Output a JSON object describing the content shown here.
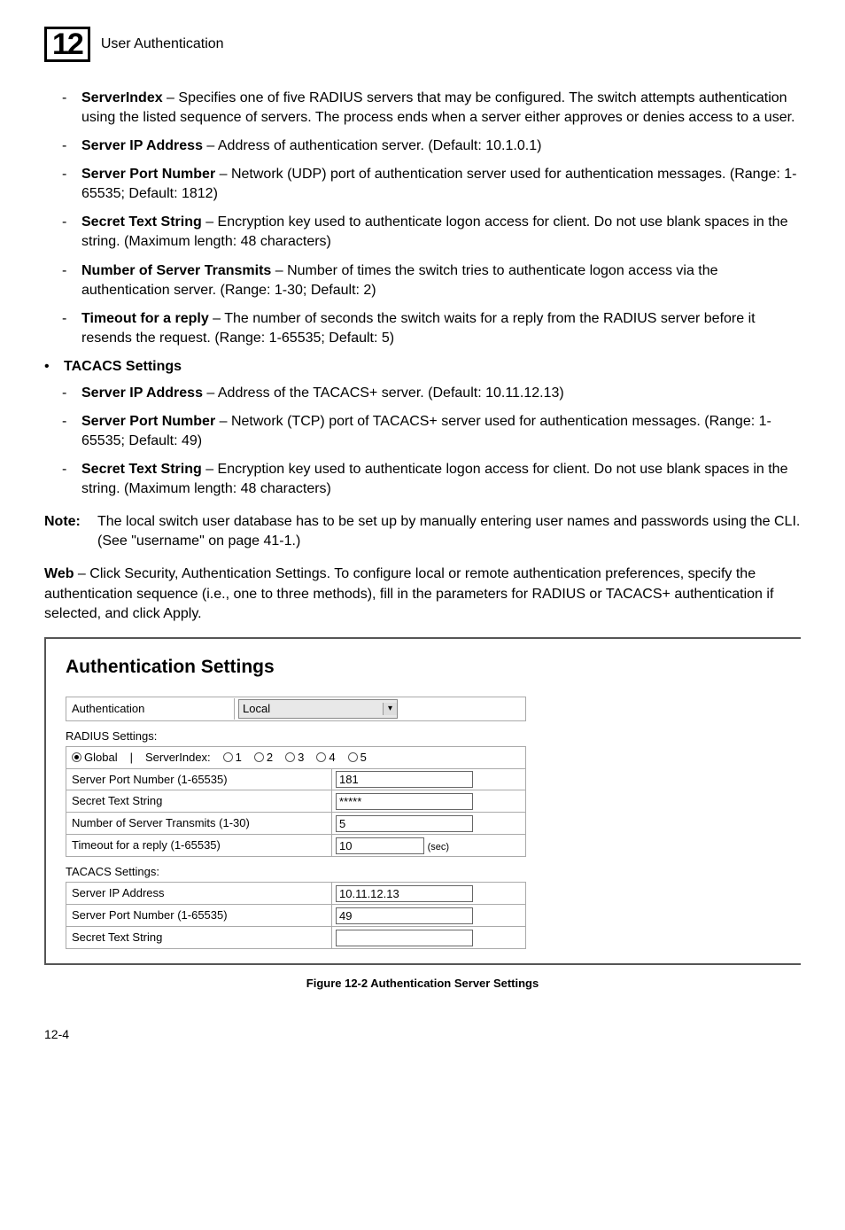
{
  "chapter": {
    "number": "12",
    "title": "User Authentication"
  },
  "items": {
    "serverIndex": {
      "name": "ServerIndex",
      "desc": " – Specifies one of five RADIUS servers that may be configured. The switch attempts authentication using the listed sequence of servers. The process ends when a server either approves or denies access to a user."
    },
    "serverIP1": {
      "name": "Server IP Address",
      "desc": " – Address of authentication server. (Default: 10.1.0.1)"
    },
    "serverPort1": {
      "name": "Server Port Number",
      "desc": " – Network (UDP) port of authentication server used for authentication messages. (Range: 1-65535; Default: 1812)"
    },
    "secret1": {
      "name": "Secret Text String",
      "desc": " – Encryption key used to authenticate logon access for client. Do not use blank spaces in the string. (Maximum length: 48 characters)"
    },
    "transmits": {
      "name": "Number of Server Transmits",
      "desc": " – Number of times the switch tries to authenticate logon access via the authentication server. (Range: 1-30; Default: 2)"
    },
    "timeout": {
      "name": "Timeout for a reply",
      "desc": " – The number of seconds the switch waits for a reply from the RADIUS server before it resends the request. (Range: 1-65535; Default: 5)"
    },
    "tacacs": {
      "name": "TACACS Settings"
    },
    "serverIP2": {
      "name": "Server IP Address",
      "desc": " – Address of the TACACS+ server. (Default: 10.11.12.13)"
    },
    "serverPort2": {
      "name": "Server Port Number",
      "desc": " – Network (TCP) port of TACACS+ server used for authentication messages. (Range: 1-65535; Default: 49)"
    },
    "secret2": {
      "name": "Secret Text String",
      "desc": " – Encryption key used to authenticate logon access for client. Do not use blank spaces in the string. (Maximum length: 48 characters)"
    }
  },
  "note": {
    "label": "Note:",
    "text": "The local switch user database has to be set up by manually entering user names and passwords using the CLI. (See \"username\" on page 41-1.)"
  },
  "webPara": {
    "bold": "Web",
    "text": " – Click Security, Authentication Settings. To configure local or remote authentication preferences, specify the authentication sequence (i.e., one to three methods), fill in the parameters for RADIUS or TACACS+ authentication if selected, and click Apply."
  },
  "screenshot": {
    "title": "Authentication Settings",
    "authLabel": "Authentication",
    "authValue": "Local",
    "radiusHeading": "RADIUS Settings:",
    "globalLabel": "Global",
    "serverIndexLabel": "ServerIndex:",
    "opt1": "1",
    "opt2": "2",
    "opt3": "3",
    "opt4": "4",
    "opt5": "5",
    "portLabel": "Server Port Number (1-65535)",
    "portValue": "181",
    "secretLabel": "Secret Text String",
    "secretValue": "*****",
    "transmitsLabel": "Number of Server Transmits (1-30)",
    "transmitsValue": "5",
    "timeoutLabel": "Timeout for a reply (1-65535)",
    "timeoutValue": "10",
    "secUnit": "(sec)",
    "tacacsHeading": "TACACS Settings:",
    "tIpLabel": "Server IP Address",
    "tIpValue": "10.11.12.13",
    "tPortLabel": "Server Port Number (1-65535)",
    "tPortValue": "49",
    "tSecretLabel": "Secret Text String",
    "tSecretValue": ""
  },
  "figureCaption": "Figure 12-2  Authentication Server Settings",
  "pageNum": "12-4"
}
